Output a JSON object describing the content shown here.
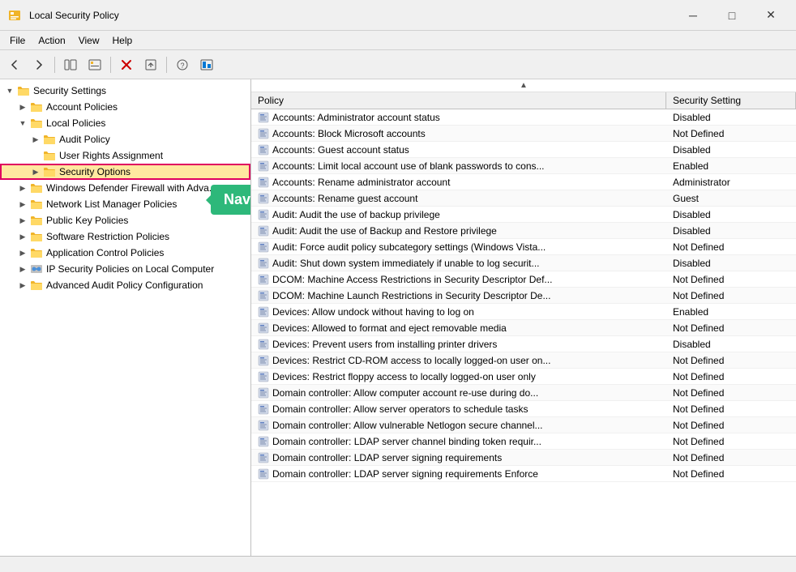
{
  "window": {
    "title": "Local Security Policy",
    "icon": "🔒"
  },
  "titlebar": {
    "minimize_label": "─",
    "maximize_label": "□",
    "close_label": "✕"
  },
  "menubar": {
    "items": [
      "File",
      "Action",
      "View",
      "Help"
    ]
  },
  "toolbar": {
    "buttons": [
      "◀",
      "▶",
      "📁",
      "🗂",
      "✕",
      "↩",
      "❓",
      "🖥"
    ]
  },
  "tree": {
    "root": "Security Settings",
    "items": [
      {
        "id": "account-policies",
        "label": "Account Policies",
        "level": 1,
        "expanded": false,
        "icon": "folder"
      },
      {
        "id": "local-policies",
        "label": "Local Policies",
        "level": 1,
        "expanded": true,
        "icon": "folder"
      },
      {
        "id": "audit-policy",
        "label": "Audit Policy",
        "level": 2,
        "expanded": false,
        "icon": "folder"
      },
      {
        "id": "user-rights",
        "label": "User Rights Assignment",
        "level": 2,
        "expanded": false,
        "icon": "folder"
      },
      {
        "id": "security-options",
        "label": "Security Options",
        "level": 2,
        "expanded": false,
        "icon": "folder",
        "highlighted": true
      },
      {
        "id": "windows-defender",
        "label": "Windows Defender Firewall with Adva...",
        "level": 1,
        "expanded": false,
        "icon": "folder"
      },
      {
        "id": "network-list",
        "label": "Network List Manager Policies",
        "level": 1,
        "expanded": false,
        "icon": "folder"
      },
      {
        "id": "public-key",
        "label": "Public Key Policies",
        "level": 1,
        "expanded": false,
        "icon": "folder"
      },
      {
        "id": "software-restriction",
        "label": "Software Restriction Policies",
        "level": 1,
        "expanded": false,
        "icon": "folder"
      },
      {
        "id": "app-control",
        "label": "Application Control Policies",
        "level": 1,
        "expanded": false,
        "icon": "folder"
      },
      {
        "id": "ip-security",
        "label": "IP Security Policies on Local Computer",
        "level": 1,
        "expanded": false,
        "icon": "special"
      },
      {
        "id": "advanced-audit",
        "label": "Advanced Audit Policy Configuration",
        "level": 1,
        "expanded": false,
        "icon": "folder"
      }
    ]
  },
  "list": {
    "header": {
      "policy_label": "Policy",
      "setting_label": "Security Setting"
    },
    "rows": [
      {
        "policy": "Accounts: Administrator account status",
        "setting": "Disabled"
      },
      {
        "policy": "Accounts: Block Microsoft accounts",
        "setting": "Not Defined"
      },
      {
        "policy": "Accounts: Guest account status",
        "setting": "Disabled"
      },
      {
        "policy": "Accounts: Limit local account use of blank passwords to cons...",
        "setting": "Enabled"
      },
      {
        "policy": "Accounts: Rename administrator account",
        "setting": "Administrator"
      },
      {
        "policy": "Accounts: Rename guest account",
        "setting": "Guest"
      },
      {
        "policy": "Audit: Audit the use of backup privilege",
        "setting": "Disabled"
      },
      {
        "policy": "Audit: Audit the use of Backup and Restore privilege",
        "setting": "Disabled"
      },
      {
        "policy": "Audit: Force audit policy subcategory settings (Windows Vista...",
        "setting": "Not Defined"
      },
      {
        "policy": "Audit: Shut down system immediately if unable to log securit...",
        "setting": "Disabled"
      },
      {
        "policy": "DCOM: Machine Access Restrictions in Security Descriptor Def...",
        "setting": "Not Defined"
      },
      {
        "policy": "DCOM: Machine Launch Restrictions in Security Descriptor De...",
        "setting": "Not Defined"
      },
      {
        "policy": "Devices: Allow undock without having to log on",
        "setting": "Enabled"
      },
      {
        "policy": "Devices: Allowed to format and eject removable media",
        "setting": "Not Defined"
      },
      {
        "policy": "Devices: Prevent users from installing printer drivers",
        "setting": "Disabled"
      },
      {
        "policy": "Devices: Restrict CD-ROM access to locally logged-on user on...",
        "setting": "Not Defined"
      },
      {
        "policy": "Devices: Restrict floppy access to locally logged-on user only",
        "setting": "Not Defined"
      },
      {
        "policy": "Domain controller: Allow computer account re-use during do...",
        "setting": "Not Defined"
      },
      {
        "policy": "Domain controller: Allow server operators to schedule tasks",
        "setting": "Not Defined"
      },
      {
        "policy": "Domain controller: Allow vulnerable Netlogon secure channel...",
        "setting": "Not Defined"
      },
      {
        "policy": "Domain controller: LDAP server channel binding token requir...",
        "setting": "Not Defined"
      },
      {
        "policy": "Domain controller: LDAP server signing requirements",
        "setting": "Not Defined"
      },
      {
        "policy": "Domain controller: LDAP server signing requirements Enforce",
        "setting": "Not Defined"
      }
    ]
  },
  "annotation": {
    "tooltip_text": "Navigate to this directory"
  },
  "statusbar": {
    "text": ""
  }
}
